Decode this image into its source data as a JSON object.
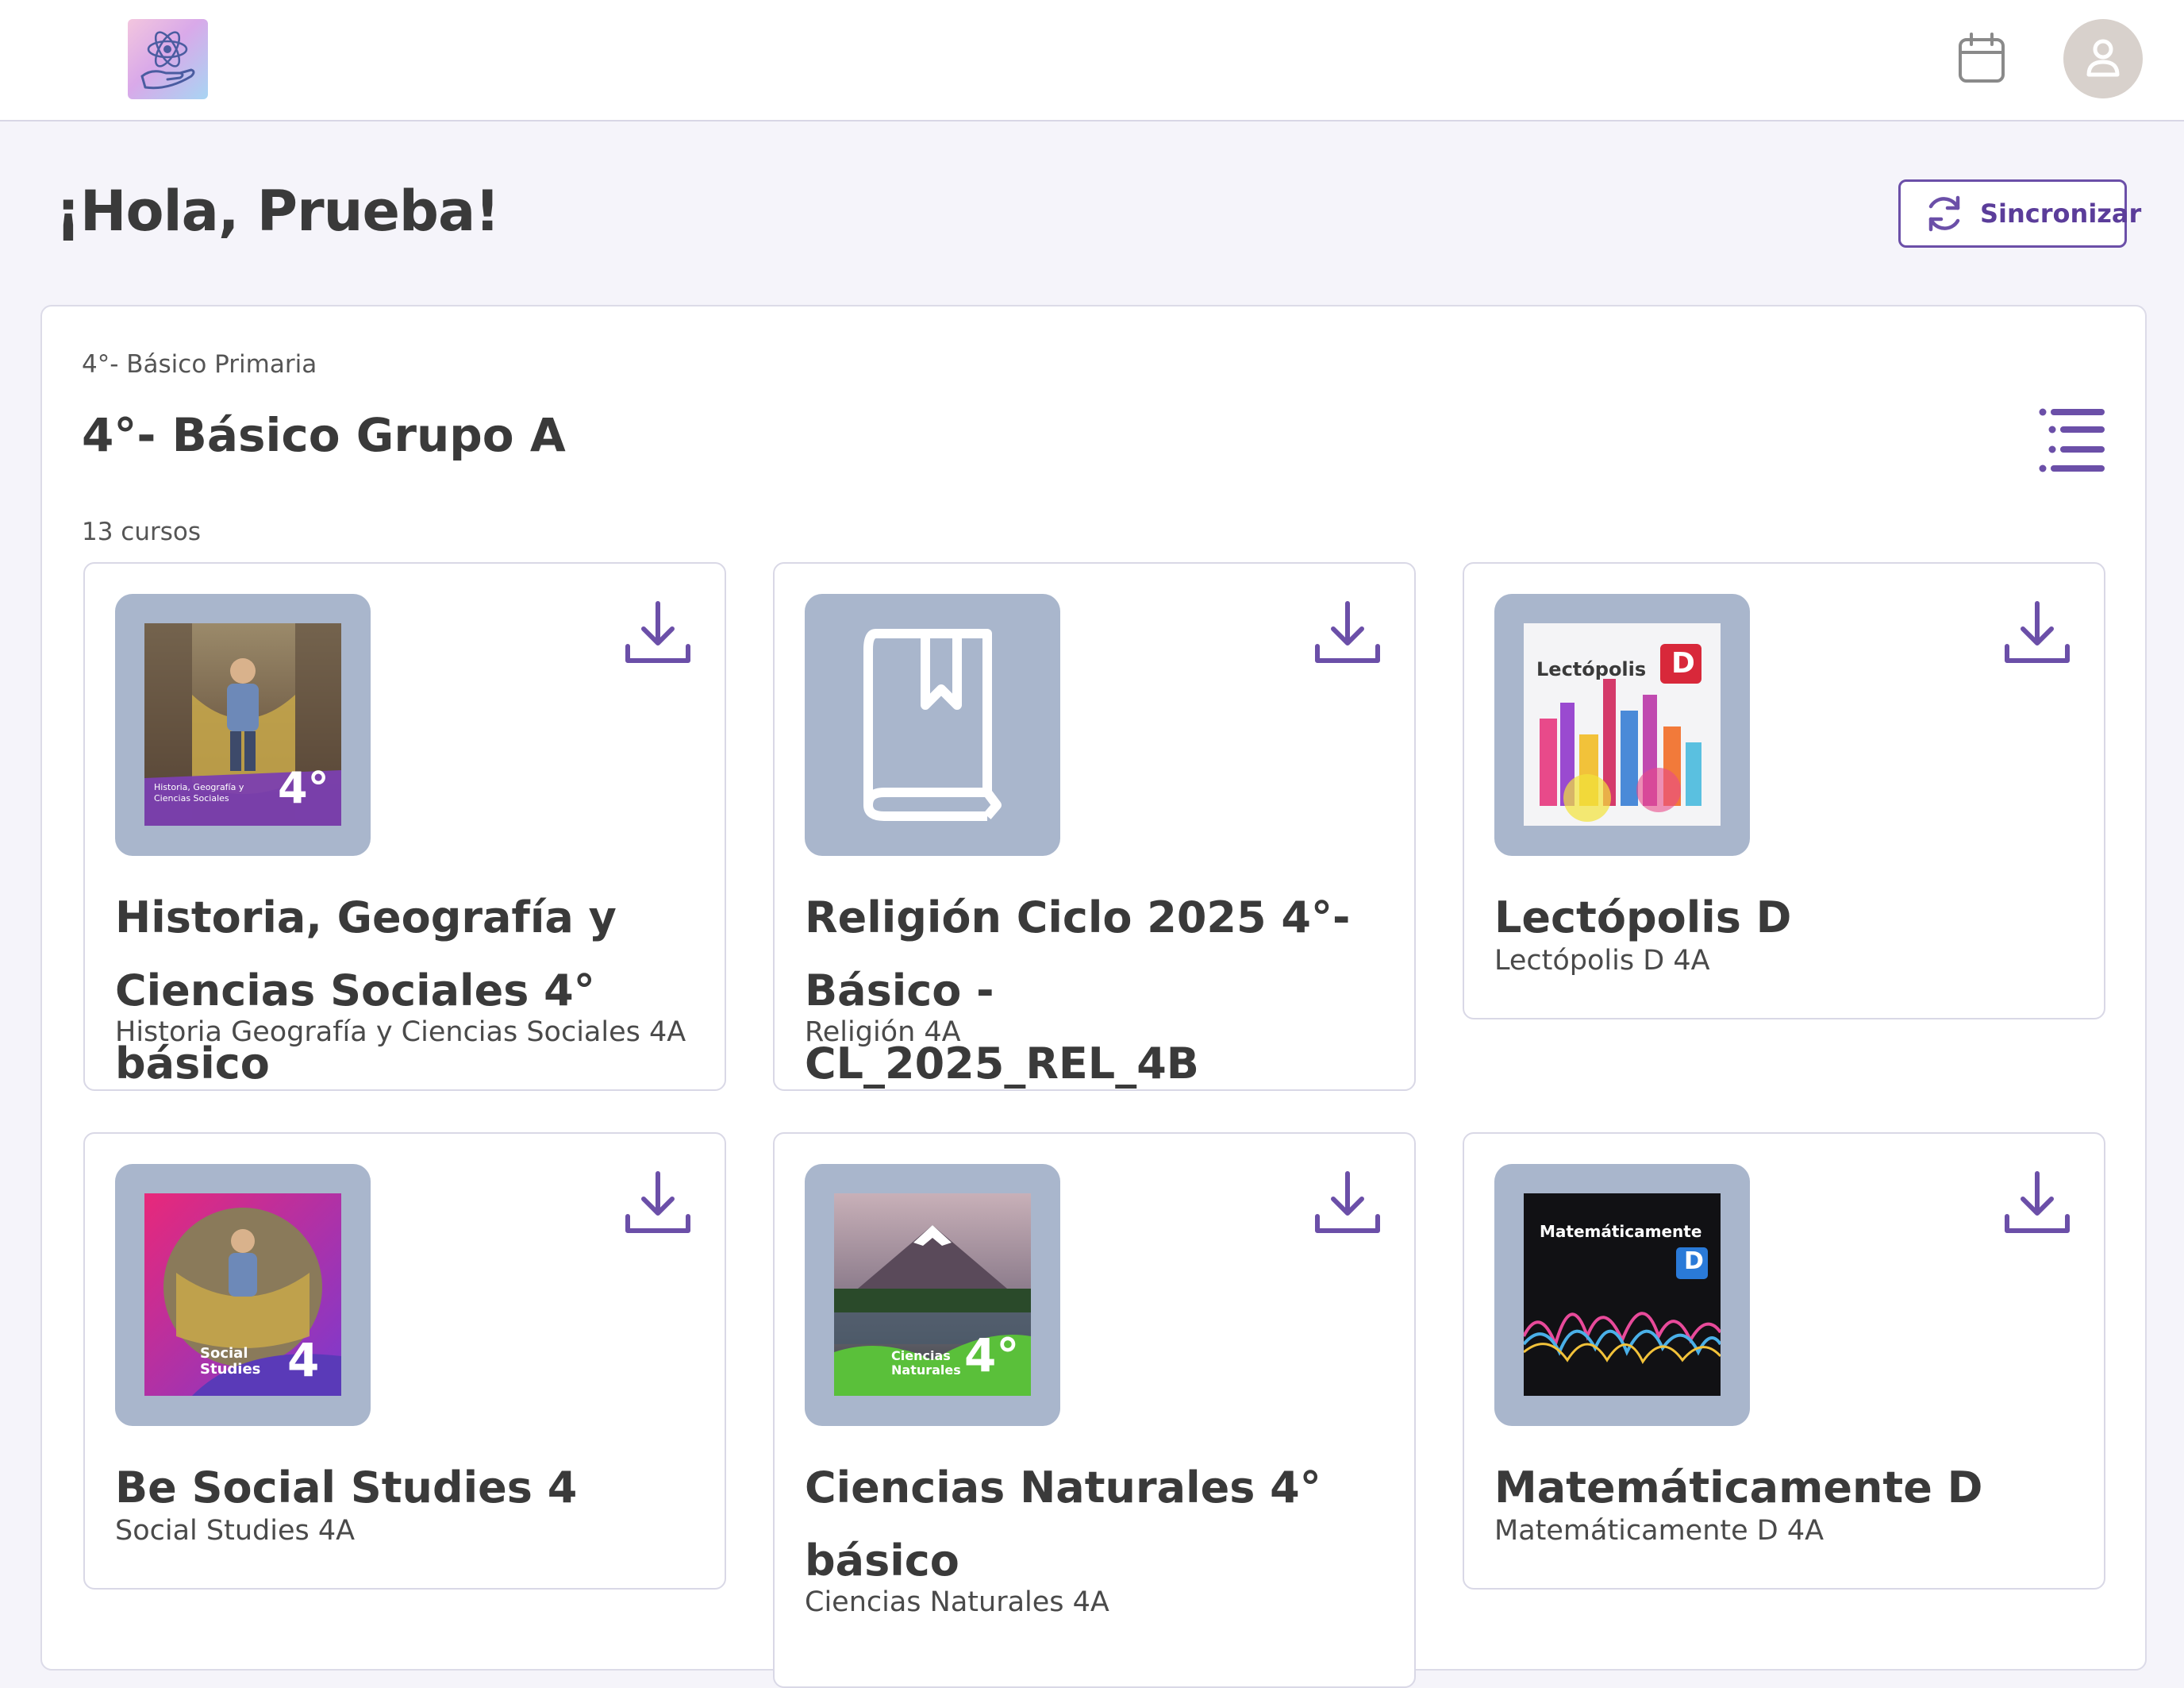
{
  "header": {
    "logo_icon": "atom-hand-logo",
    "calendar_icon": "calendar-icon",
    "avatar_icon": "user-avatar-icon"
  },
  "greeting": "¡Hola, Prueba!",
  "sync_label": "Sincronizar",
  "group": {
    "level": "4°- Básico Primaria",
    "title": "4°- Básico Grupo A",
    "count": "13 cursos"
  },
  "courses": [
    {
      "title": "Historia, Geografía y Ciencias Sociales 4° básico",
      "subtitle": "Historia Geografía y Ciencias Sociales 4A",
      "cover_text": "Historia, Geografía y Ciencias Sociales",
      "cover_number": "4°"
    },
    {
      "title": "Religión Ciclo 2025 4°- Básico - CL_2025_REL_4B",
      "subtitle": "Religión 4A"
    },
    {
      "title": "Lectópolis D",
      "subtitle": "Lectópolis D 4A",
      "cover_text": "Lectópolis",
      "cover_letter": "D"
    },
    {
      "title": "Be Social Studies 4",
      "subtitle": "Social Studies 4A",
      "cover_text": "Social Studies",
      "cover_number": "4"
    },
    {
      "title": "Ciencias Naturales 4° básico",
      "subtitle": "Ciencias Naturales 4A",
      "cover_text": "Ciencias Naturales",
      "cover_number": "4°"
    },
    {
      "title": "Matemáticamente D",
      "subtitle": "Matemáticamente D 4A",
      "cover_text": "Matemáticamente",
      "cover_letter": "D"
    }
  ],
  "colors": {
    "accent": "#6b4fa8",
    "thumb_bg": "#a9b6cc",
    "page_bg": "#f5f4fa"
  }
}
